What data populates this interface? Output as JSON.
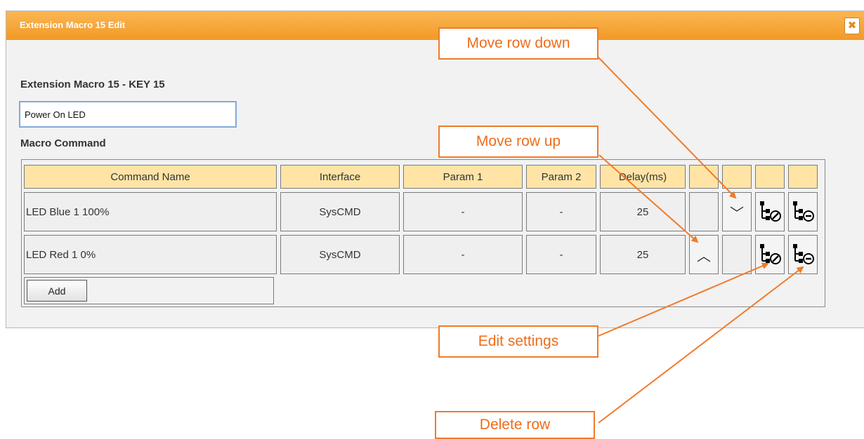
{
  "dialog": {
    "title": "Extension Macro 15 Edit",
    "close_glyph": "✖",
    "close_icon": "close-icon"
  },
  "macro": {
    "label": "Extension Macro 15 - KEY 15",
    "name_value": "Power On LED",
    "commands_label": "Macro Command"
  },
  "table": {
    "headers": [
      "Command Name",
      "Interface",
      "Param 1",
      "Param 2",
      "Delay(ms)",
      "",
      "",
      "",
      ""
    ],
    "rows": [
      {
        "command": "LED Blue 1 100%",
        "interface": "SysCMD",
        "param1": "-",
        "param2": "-",
        "delay": "25",
        "up": "",
        "down": "﹀"
      },
      {
        "command": "LED Red 1 0%",
        "interface": "SysCMD",
        "param1": "-",
        "param2": "-",
        "delay": "25",
        "up": "︿",
        "down": ""
      }
    ],
    "icons": {
      "up": "chevron-up-icon",
      "down": "chevron-down-icon",
      "edit": "edit-settings-icon",
      "delete": "delete-row-icon"
    },
    "add_label": "Add"
  },
  "callouts": {
    "move_down": "Move row down",
    "move_up": "Move row up",
    "edit": "Edit settings",
    "delete": "Delete row"
  },
  "colors": {
    "title_bar": "#f5a73b",
    "header_cell": "#ffe4a6",
    "callout_accent": "#f07b2a"
  }
}
